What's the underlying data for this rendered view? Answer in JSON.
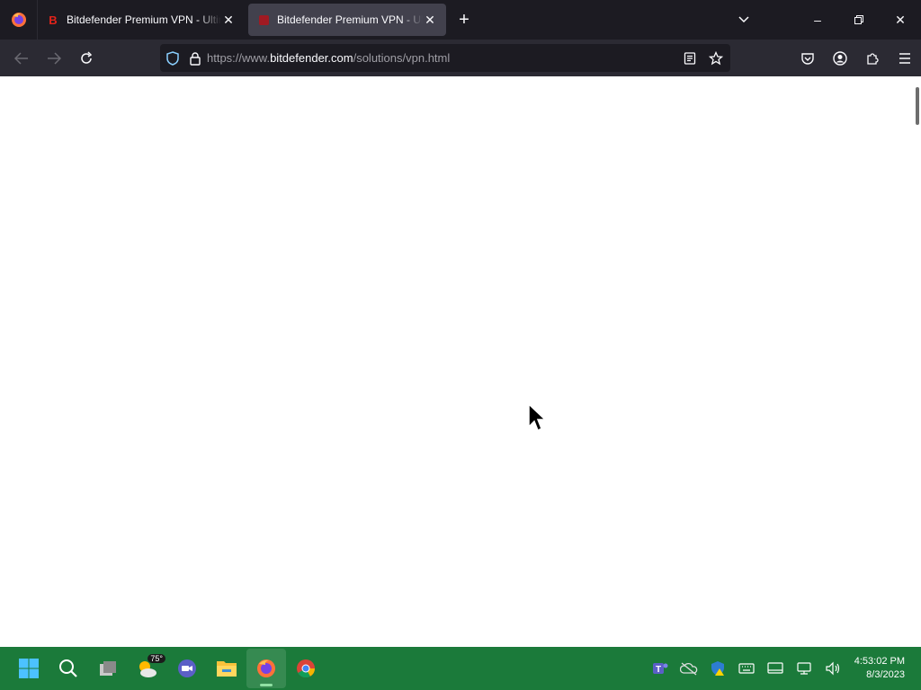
{
  "tabs": [
    {
      "title": "Bitdefender Premium VPN - Ultimate Privacy Online",
      "active": false
    },
    {
      "title": "Bitdefender Premium VPN - Ultimate Privacy Online",
      "active": true
    }
  ],
  "url": {
    "prefix": "https://www.",
    "domain": "bitdefender.com",
    "path": "/solutions/vpn.html"
  },
  "weather_badge": "75°",
  "clock": {
    "time": "4:53:02 PM",
    "date": "8/3/2023"
  }
}
